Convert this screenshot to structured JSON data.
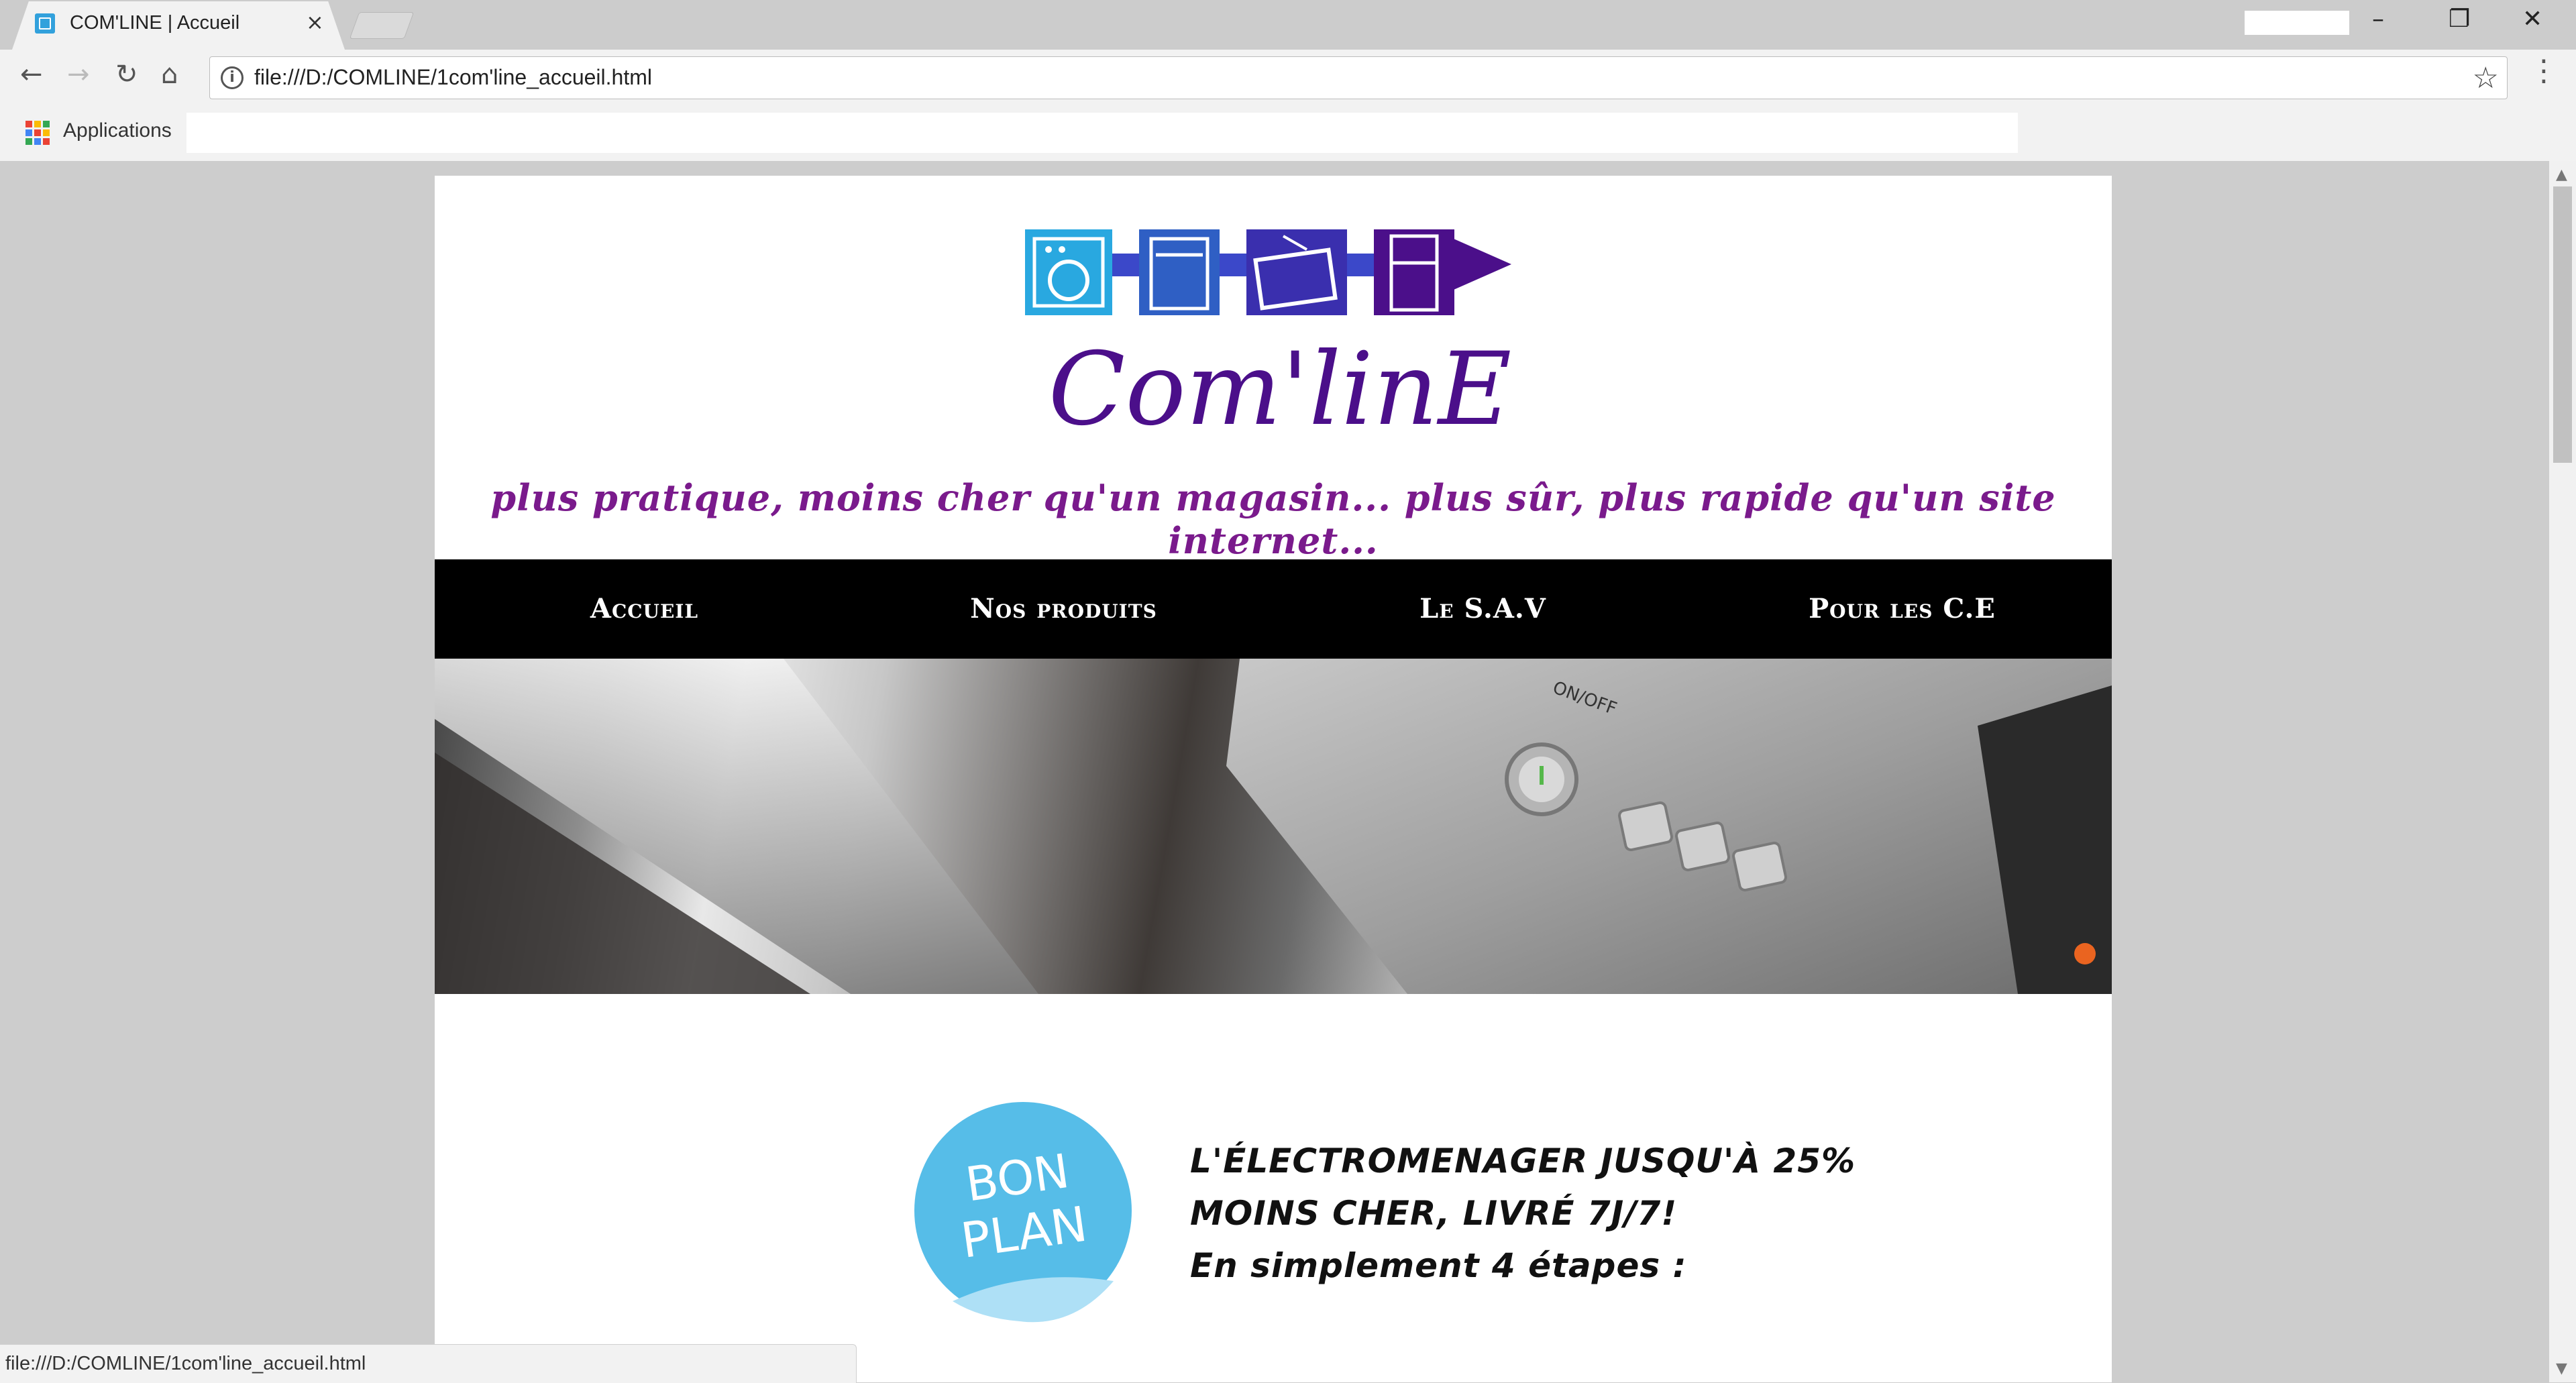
{
  "browser": {
    "tab_title": "COM'LINE | Accueil",
    "tab_close": "×",
    "url": "file:///D:/COMLINE/1com'line_accueil.html",
    "bookmarks_apps_label": "Applications",
    "status_url": "file:///D:/COMLINE/1com'line_accueil.html",
    "icons": {
      "back": "←",
      "forward": "→",
      "reload": "↻",
      "home": "⌂",
      "info": "i",
      "star": "☆",
      "menu": "⋮",
      "minimize": "–",
      "maximize": "❐",
      "close": "✕"
    }
  },
  "site": {
    "logo_text": "Com'linE",
    "tagline": "plus pratique, moins cher qu'un magasin... plus sûr, plus rapide qu'un site internet...",
    "nav": [
      "Accueil",
      "Nos produits",
      "Le S.A.V",
      "Pour les C.E"
    ],
    "hero_labels": {
      "on_off": "ON/OFF"
    },
    "promo": {
      "badge_line1": "BON",
      "badge_line2": "PLAN",
      "lines": [
        "L'ÉLECTROMENAGER JUSQU'À 25%",
        "MOINS CHER, LIVRÉ 7J/7!",
        "En simplement 4 étapes :"
      ]
    }
  },
  "colors": {
    "logo_purple": "#4b0f8a",
    "tagline_purple": "#7a1a8c",
    "logo_cyan": "#29a8e0",
    "logo_blue": "#2f5fc4",
    "badge_blue": "#56bde8",
    "nav_bg": "#000000"
  }
}
